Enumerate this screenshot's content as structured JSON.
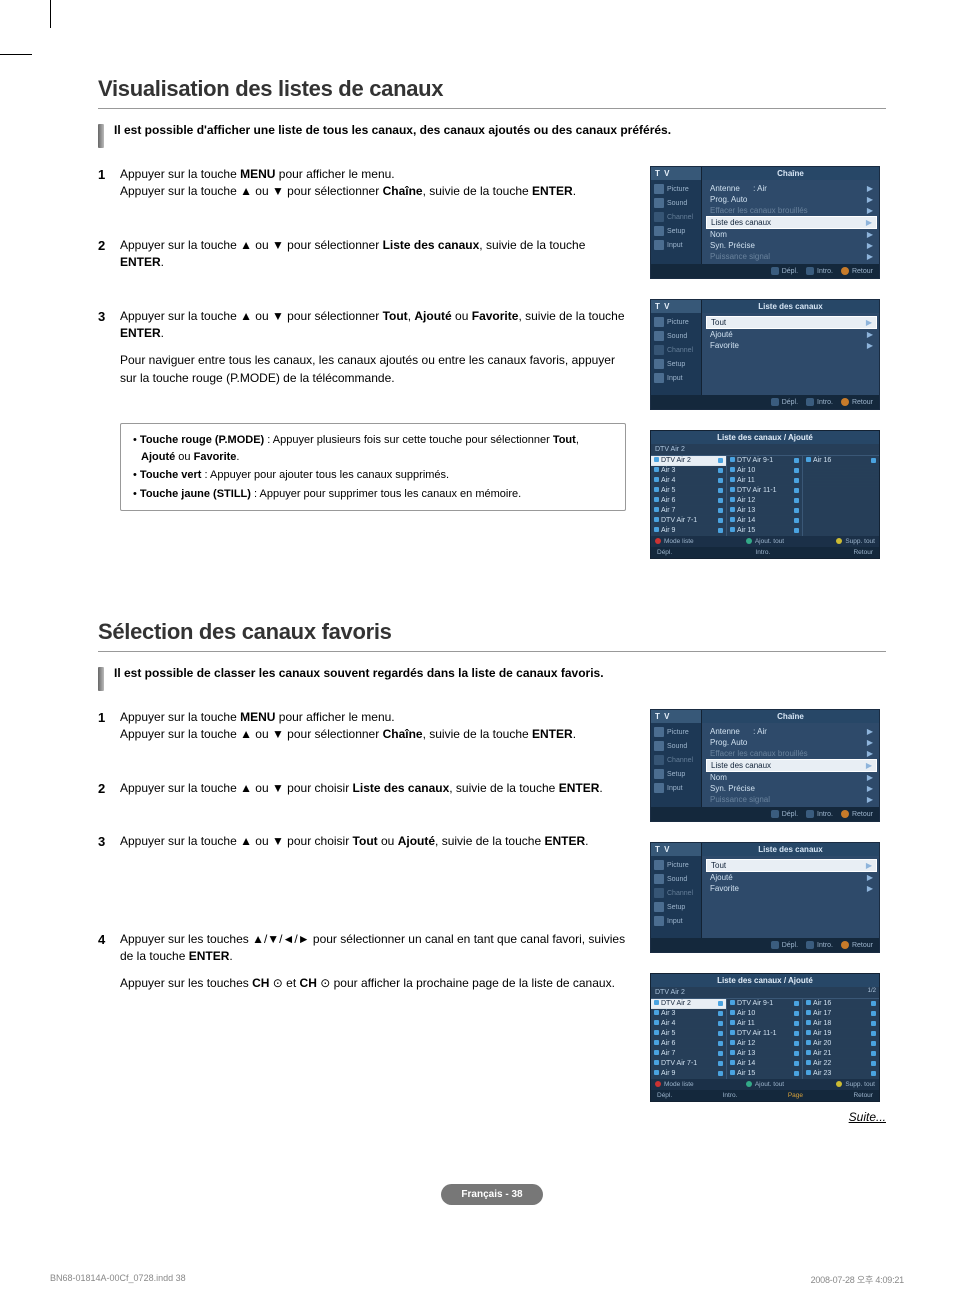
{
  "section1": {
    "title": "Visualisation des listes de canaux",
    "lead": "Il est possible d'afficher une liste de tous les canaux, des canaux ajoutés ou des canaux préférés.",
    "steps": [
      {
        "num": "1",
        "l1a": "Appuyer sur la touche",
        "b1": "MENU",
        "l1b": "pour afficher le menu.",
        "l2a": "Appuyer sur la touche ▲ ou ▼ pour sélectionner",
        "b2": "Chaîne",
        "l2b": ", suivie de la touche",
        "b3": "ENTER",
        "l2c": "."
      },
      {
        "num": "2",
        "l1a": "Appuyer sur la touche ▲ ou ▼ pour sélectionner",
        "b1": "Liste des canaux",
        "l1b": ", suivie de la touche",
        "b2": "ENTER",
        "l1c": "."
      },
      {
        "num": "3",
        "l1a": "Appuyer sur la touche ▲ ou ▼ pour sélectionner",
        "b1": "Tout",
        "b2": "Ajouté",
        "or": "ou",
        "b3": "Favorite",
        "l1b": ", suivie de la touche",
        "b4": "ENTER",
        "p2": "Pour naviguer entre tous les canaux, les canaux ajoutés ou entre les canaux favoris, appuyer sur la touche rouge (P.MODE) de la télécommande."
      }
    ],
    "bullets": [
      {
        "b": "Touche rouge (P.MODE)",
        "t1": ": Appuyer plusieurs fois sur cette touche pour sélectionner",
        "w1": "Tout",
        "w2": "Ajouté",
        "or": "ou",
        "w3": "Favorite"
      },
      {
        "b": "Touche vert",
        "t": ": Appuyer pour ajouter tous les canaux supprimés."
      },
      {
        "b": "Touche jaune (STILL)",
        "t": ": Appuyer pour supprimer tous les canaux en mémoire."
      }
    ]
  },
  "section2": {
    "title": "Sélection des canaux favoris",
    "lead": "Il est possible de classer les canaux souvent regardés dans la liste de canaux favoris.",
    "steps": [
      {
        "num": "1",
        "l1a": "Appuyer sur la touche",
        "b1": "MENU",
        "l1b": "pour afficher le menu.",
        "l2a": "Appuyer sur la touche ▲ ou ▼ pour sélectionner",
        "b2": "Chaîne",
        "l2b": ", suivie de la touche",
        "b3": "ENTER"
      },
      {
        "num": "2",
        "l1a": "Appuyer sur la touche ▲ ou ▼ pour choisir",
        "b1": "Liste des canaux",
        "l1b": ", suivie de la touche",
        "b2": "ENTER"
      },
      {
        "num": "3",
        "l1a": "Appuyer sur la touche ▲ ou ▼ pour choisir",
        "b1": "Tout",
        "or": "ou",
        "b2": "Ajouté",
        "l1b": ", suivie de la touche",
        "b3": "ENTER"
      },
      {
        "num": "4",
        "l1a": "Appuyer sur les touches ▲/▼/◄/► pour sélectionner un canal en tant que canal favori, suivies de la touche",
        "b1": "ENTER",
        "l2a": "Appuyer sur les touches",
        "b2": "CH",
        "and": "et",
        "b3": "CH",
        "l2b": "pour afficher la prochaine page de la liste de canaux."
      }
    ]
  },
  "osd": {
    "tv": "T V",
    "side": {
      "picture": "Picture",
      "sound": "Sound",
      "channel": "Channel",
      "setup": "Setup",
      "input": "Input"
    },
    "chaine": {
      "title": "Chaîne",
      "air": ": Air",
      "items": [
        "Antenne",
        "Prog. Auto",
        "Effacer les canaux brouillés",
        "Liste des canaux",
        "Nom",
        "Syn. Précise",
        "Puissance signal"
      ]
    },
    "liste": {
      "title": "Liste des canaux",
      "items": [
        "Tout",
        "Ajouté",
        "Favorite"
      ]
    },
    "footer": {
      "depl": "Dépl.",
      "intro": "Intro.",
      "retour": "Retour"
    }
  },
  "clist": {
    "actions": {
      "mode": "Mode liste",
      "ajout": "Ajout. tout",
      "supp": "Supp. tout"
    }
  },
  "clist1": {
    "title": "Liste des canaux / Ajouté",
    "current": "DTV Air 2",
    "cols": [
      [
        "DTV Air 2",
        "Air 3",
        "Air 4",
        "Air 5",
        "Air 6",
        "Air 7",
        "DTV Air 7-1",
        "Air 9"
      ],
      [
        "DTV Air 9-1",
        "Air 10",
        "Air 11",
        "DTV Air 11-1",
        "Air 12",
        "Air 13",
        "Air 14",
        "Air 15"
      ],
      [
        "Air 16",
        "",
        "",
        "",
        "",
        "",
        "",
        ""
      ]
    ]
  },
  "clist2": {
    "title": "Liste des canaux / Ajouté",
    "current": "DTV Air 2",
    "page": "1/2",
    "pageAction": "Page",
    "cols": [
      [
        "DTV Air 2",
        "Air 3",
        "Air 4",
        "Air 5",
        "Air 6",
        "Air 7",
        "DTV Air 7-1",
        "Air 9"
      ],
      [
        "DTV Air 9-1",
        "Air 10",
        "Air 11",
        "DTV Air 11-1",
        "Air 12",
        "Air 13",
        "Air 14",
        "Air 15"
      ],
      [
        "Air 16",
        "Air 17",
        "Air 18",
        "Air 19",
        "Air 20",
        "Air 21",
        "Air 22",
        "Air 23"
      ]
    ]
  },
  "continueText": "Suite...",
  "pageBadge": "Français - 38",
  "footer": {
    "left": "BN68-01814A-00Cf_0728.indd   38",
    "right": "2008-07-28   오후 4:09:21"
  }
}
